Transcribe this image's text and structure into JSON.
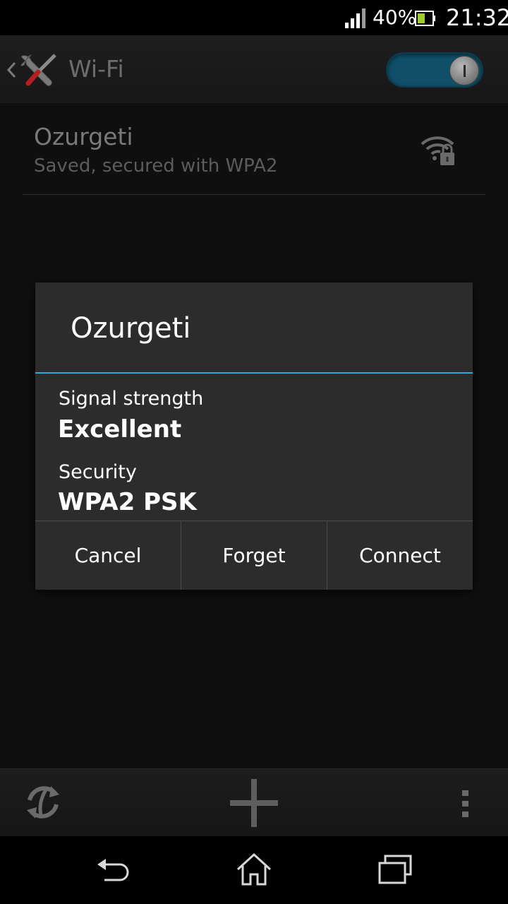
{
  "status_bar": {
    "battery_percent": "40%",
    "time": "21:32"
  },
  "action_bar": {
    "title": "Wi-Fi",
    "wifi_enabled": true,
    "toggle_color": "#0f4f68"
  },
  "network_list": {
    "items": [
      {
        "name": "Ozurgeti",
        "status": "Saved, secured with WPA2",
        "icon": "wifi-lock-icon"
      }
    ]
  },
  "dialog": {
    "title": "Ozurgeti",
    "accent_color": "#33a6d8",
    "fields": [
      {
        "label": "Signal strength",
        "value": "Excellent"
      },
      {
        "label": "Security",
        "value": "WPA2 PSK"
      }
    ],
    "buttons": {
      "cancel": "Cancel",
      "forget": "Forget",
      "connect": "Connect"
    }
  },
  "bottom_toolbar": {
    "icons": [
      "refresh-icon",
      "add-icon",
      "overflow-menu-icon"
    ]
  },
  "nav_bar": {
    "icons": [
      "back-icon",
      "home-icon",
      "recent-apps-icon"
    ]
  }
}
